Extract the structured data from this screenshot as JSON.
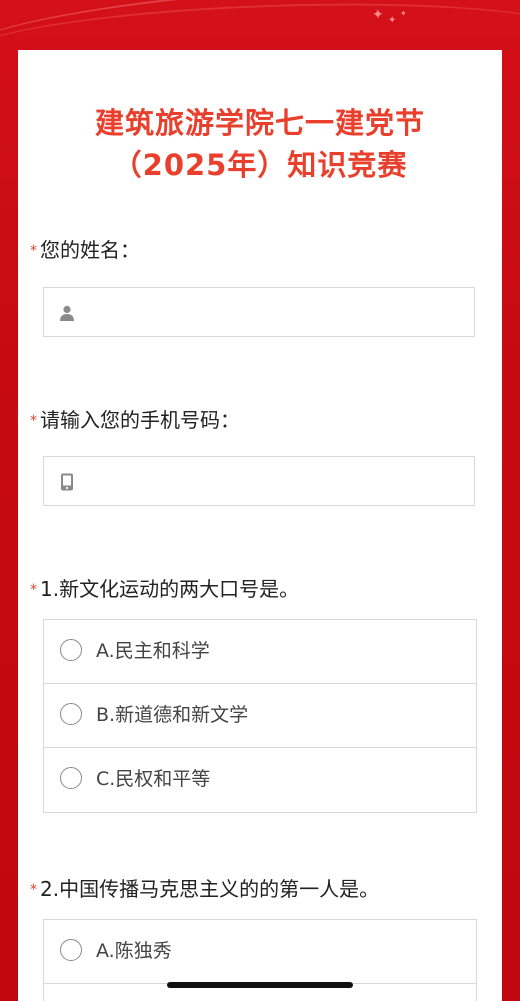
{
  "survey": {
    "title_line1": "建筑旅游学院七一建党节",
    "title_line2": "（2025年）知识竞赛"
  },
  "colors": {
    "page_background": "#c8080f",
    "title": "#e8402d",
    "required_marker": "#e8402d",
    "card": "#ffffff",
    "border": "#d8d8d8"
  },
  "questions": [
    {
      "required_mark": "*",
      "label": "您的姓名：",
      "type": "text",
      "icon": "person-icon",
      "value": "",
      "placeholder": ""
    },
    {
      "required_mark": "*",
      "label": "请输入您的手机号码：",
      "type": "text",
      "icon": "mobile-phone-icon",
      "value": "",
      "placeholder": ""
    },
    {
      "required_mark": "*",
      "label": "1.新文化运动的两大口号是。",
      "type": "single-choice",
      "options": [
        {
          "label": "A.民主和科学",
          "selected": false
        },
        {
          "label": "B.新道德和新文学",
          "selected": false
        },
        {
          "label": "C.民权和平等",
          "selected": false
        }
      ]
    },
    {
      "required_mark": "*",
      "label": "2.中国传播马克思主义的的第一人是。",
      "type": "single-choice",
      "options": [
        {
          "label": "A.陈独秀",
          "selected": false
        }
      ]
    }
  ]
}
